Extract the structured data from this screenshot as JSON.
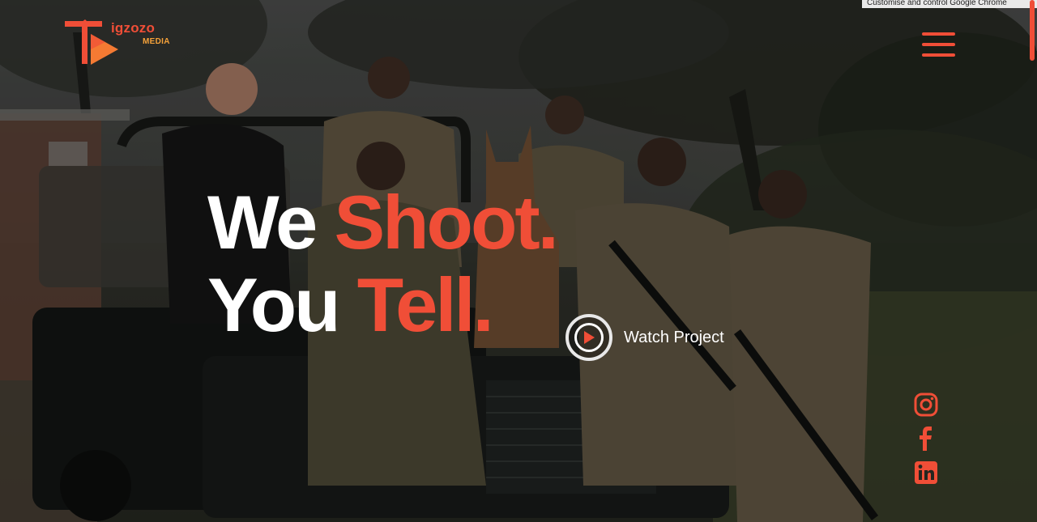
{
  "header": {
    "logo_word": "igzozo",
    "logo_sub": "MEDIA",
    "menu_icon": "hamburger-menu-icon"
  },
  "browser": {
    "banner_text": "Customise and control Google Chrome"
  },
  "hero": {
    "line1_white": "We",
    "line1_accent": "Shoot.",
    "line2_white": "You",
    "line2_accent": "Tell.",
    "watch_label": "Watch Project",
    "watch_icon": "play-icon"
  },
  "social": {
    "items": [
      {
        "name": "instagram",
        "icon": "instagram-icon"
      },
      {
        "name": "facebook",
        "icon": "facebook-icon"
      },
      {
        "name": "linkedin",
        "icon": "linkedin-icon"
      }
    ]
  },
  "colors": {
    "accent": "#f04e37",
    "logo_sub": "#f6a23a",
    "text": "#ffffff"
  }
}
